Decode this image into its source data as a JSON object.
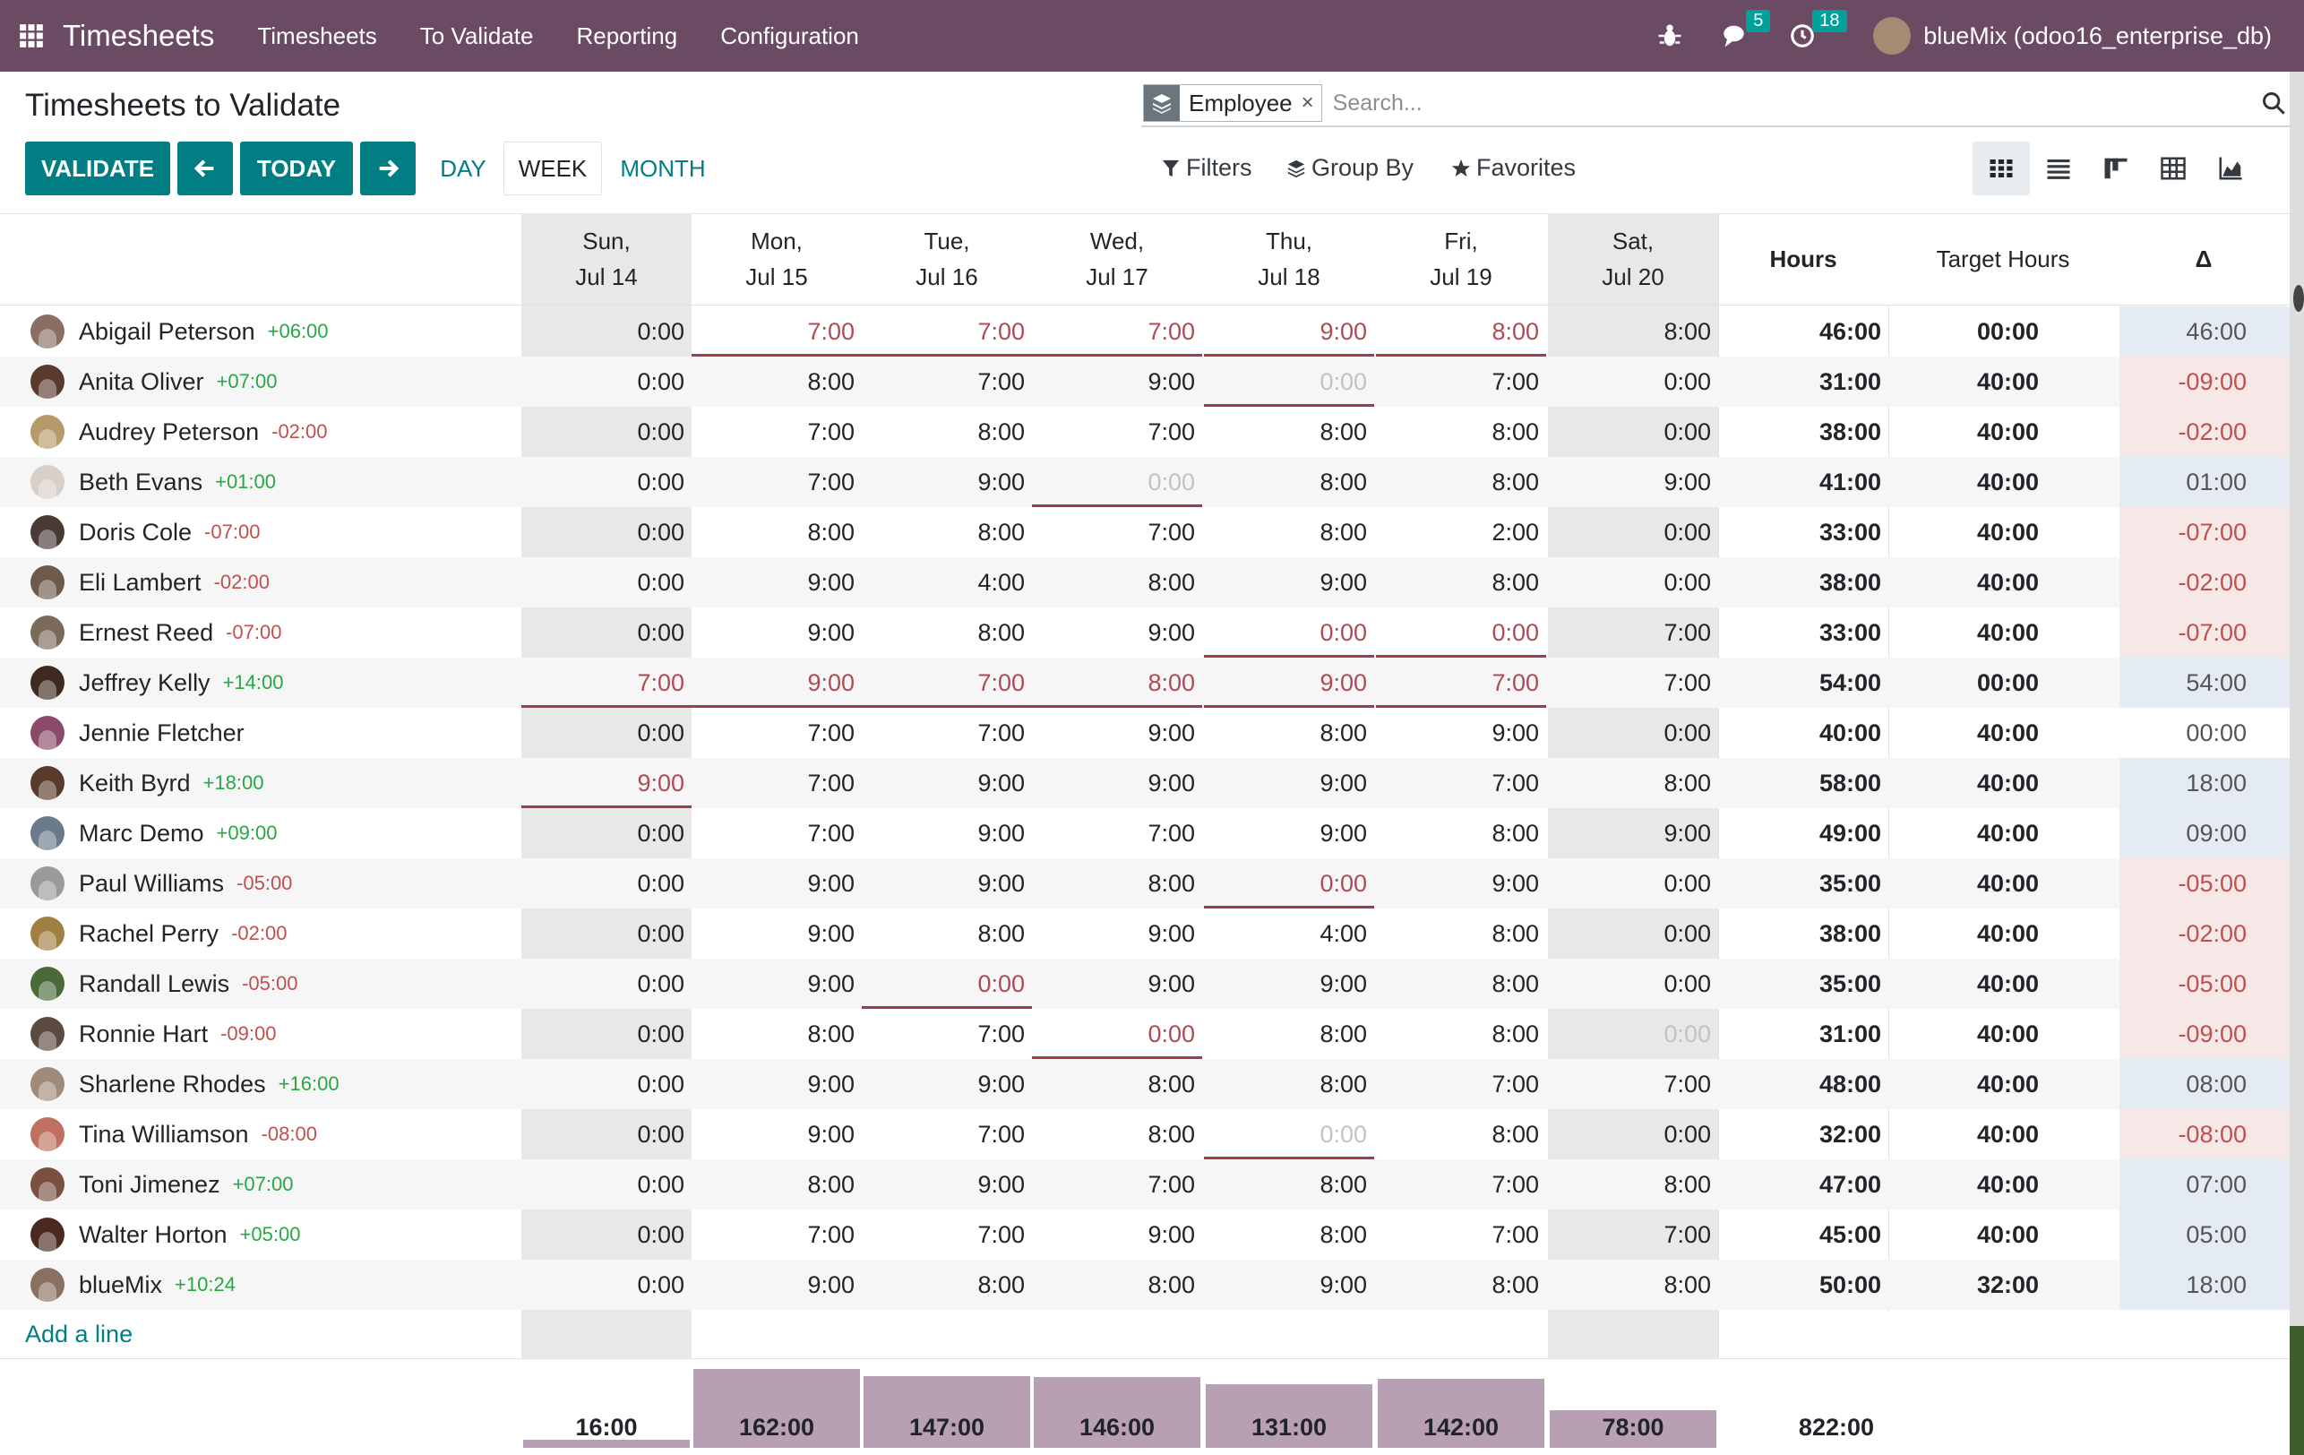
{
  "topbar": {
    "app_title": "Timesheets",
    "menu": [
      "Timesheets",
      "To Validate",
      "Reporting",
      "Configuration"
    ],
    "messages_count": "5",
    "activities_count": "18",
    "user": "blueMix (odoo16_enterprise_db)",
    "icons": [
      "apps-grid-icon",
      "bug-icon",
      "chat-icon",
      "clock-icon"
    ]
  },
  "control": {
    "title": "Timesheets to Validate",
    "validate": "VALIDATE",
    "today": "TODAY",
    "day": "DAY",
    "week": "WEEK",
    "month": "MONTH",
    "filters": "Filters",
    "group_by": "Group By",
    "favorites": "Favorites"
  },
  "search": {
    "facet": "Employee",
    "remove": "×",
    "placeholder": "Search..."
  },
  "columns": {
    "days": [
      {
        "dow": "Sun,",
        "date": "Jul 14"
      },
      {
        "dow": "Mon,",
        "date": "Jul 15"
      },
      {
        "dow": "Tue,",
        "date": "Jul 16"
      },
      {
        "dow": "Wed,",
        "date": "Jul 17"
      },
      {
        "dow": "Thu,",
        "date": "Jul 18"
      },
      {
        "dow": "Fri,",
        "date": "Jul 19"
      },
      {
        "dow": "Sat,",
        "date": "Jul 20"
      }
    ],
    "hours": "Hours",
    "target": "Target Hours",
    "delta": "Δ"
  },
  "rows": [
    {
      "name": "Abigail Peterson",
      "overtime": "+06:00",
      "days": [
        "0:00",
        "7:00",
        "7:00",
        "7:00",
        "9:00",
        "8:00",
        "8:00"
      ],
      "hours": "46:00",
      "target": "00:00",
      "delta": "46:00"
    },
    {
      "name": "Anita Oliver",
      "overtime": "+07:00",
      "days": [
        "0:00",
        "8:00",
        "7:00",
        "9:00",
        "0:00",
        "7:00",
        "0:00"
      ],
      "hours": "31:00",
      "target": "40:00",
      "delta": "-09:00"
    },
    {
      "name": "Audrey Peterson",
      "overtime": "-02:00",
      "days": [
        "0:00",
        "7:00",
        "8:00",
        "7:00",
        "8:00",
        "8:00",
        "0:00"
      ],
      "hours": "38:00",
      "target": "40:00",
      "delta": "-02:00"
    },
    {
      "name": "Beth Evans",
      "overtime": "+01:00",
      "days": [
        "0:00",
        "7:00",
        "9:00",
        "0:00",
        "8:00",
        "8:00",
        "9:00"
      ],
      "hours": "41:00",
      "target": "40:00",
      "delta": "01:00"
    },
    {
      "name": "Doris Cole",
      "overtime": "-07:00",
      "days": [
        "0:00",
        "8:00",
        "8:00",
        "7:00",
        "8:00",
        "2:00",
        "0:00"
      ],
      "hours": "33:00",
      "target": "40:00",
      "delta": "-07:00"
    },
    {
      "name": "Eli Lambert",
      "overtime": "-02:00",
      "days": [
        "0:00",
        "9:00",
        "4:00",
        "8:00",
        "9:00",
        "8:00",
        "0:00"
      ],
      "hours": "38:00",
      "target": "40:00",
      "delta": "-02:00"
    },
    {
      "name": "Ernest Reed",
      "overtime": "-07:00",
      "days": [
        "0:00",
        "9:00",
        "8:00",
        "9:00",
        "0:00",
        "0:00",
        "7:00"
      ],
      "hours": "33:00",
      "target": "40:00",
      "delta": "-07:00"
    },
    {
      "name": "Jeffrey Kelly",
      "overtime": "+14:00",
      "days": [
        "7:00",
        "9:00",
        "7:00",
        "8:00",
        "9:00",
        "7:00",
        "7:00"
      ],
      "hours": "54:00",
      "target": "00:00",
      "delta": "54:00"
    },
    {
      "name": "Jennie Fletcher",
      "overtime": "",
      "days": [
        "0:00",
        "7:00",
        "7:00",
        "9:00",
        "8:00",
        "9:00",
        "0:00"
      ],
      "hours": "40:00",
      "target": "40:00",
      "delta": "00:00"
    },
    {
      "name": "Keith Byrd",
      "overtime": "+18:00",
      "days": [
        "9:00",
        "7:00",
        "9:00",
        "9:00",
        "9:00",
        "7:00",
        "8:00"
      ],
      "hours": "58:00",
      "target": "40:00",
      "delta": "18:00"
    },
    {
      "name": "Marc Demo",
      "overtime": "+09:00",
      "days": [
        "0:00",
        "7:00",
        "9:00",
        "7:00",
        "9:00",
        "8:00",
        "9:00"
      ],
      "hours": "49:00",
      "target": "40:00",
      "delta": "09:00"
    },
    {
      "name": "Paul Williams",
      "overtime": "-05:00",
      "days": [
        "0:00",
        "9:00",
        "9:00",
        "8:00",
        "0:00",
        "9:00",
        "0:00"
      ],
      "hours": "35:00",
      "target": "40:00",
      "delta": "-05:00"
    },
    {
      "name": "Rachel Perry",
      "overtime": "-02:00",
      "days": [
        "0:00",
        "9:00",
        "8:00",
        "9:00",
        "4:00",
        "8:00",
        "0:00"
      ],
      "hours": "38:00",
      "target": "40:00",
      "delta": "-02:00"
    },
    {
      "name": "Randall Lewis",
      "overtime": "-05:00",
      "days": [
        "0:00",
        "9:00",
        "0:00",
        "9:00",
        "9:00",
        "8:00",
        "0:00"
      ],
      "hours": "35:00",
      "target": "40:00",
      "delta": "-05:00"
    },
    {
      "name": "Ronnie Hart",
      "overtime": "-09:00",
      "days": [
        "0:00",
        "8:00",
        "7:00",
        "0:00",
        "8:00",
        "8:00",
        "0:00"
      ],
      "hours": "31:00",
      "target": "40:00",
      "delta": "-09:00"
    },
    {
      "name": "Sharlene Rhodes",
      "overtime": "+16:00",
      "days": [
        "0:00",
        "9:00",
        "9:00",
        "8:00",
        "8:00",
        "7:00",
        "7:00"
      ],
      "hours": "48:00",
      "target": "40:00",
      "delta": "08:00"
    },
    {
      "name": "Tina Williamson",
      "overtime": "-08:00",
      "days": [
        "0:00",
        "9:00",
        "7:00",
        "8:00",
        "0:00",
        "8:00",
        "0:00"
      ],
      "hours": "32:00",
      "target": "40:00",
      "delta": "-08:00"
    },
    {
      "name": "Toni Jimenez",
      "overtime": "+07:00",
      "days": [
        "0:00",
        "8:00",
        "9:00",
        "7:00",
        "8:00",
        "7:00",
        "8:00"
      ],
      "hours": "47:00",
      "target": "40:00",
      "delta": "07:00"
    },
    {
      "name": "Walter Horton",
      "overtime": "+05:00",
      "days": [
        "0:00",
        "7:00",
        "7:00",
        "9:00",
        "8:00",
        "7:00",
        "7:00"
      ],
      "hours": "45:00",
      "target": "40:00",
      "delta": "05:00"
    },
    {
      "name": "blueMix",
      "overtime": "+10:24",
      "days": [
        "0:00",
        "9:00",
        "8:00",
        "8:00",
        "9:00",
        "8:00",
        "8:00"
      ],
      "hours": "50:00",
      "target": "32:00",
      "delta": "18:00"
    }
  ],
  "add_line": "Add a line",
  "totals": {
    "days": [
      "16:00",
      "162:00",
      "147:00",
      "146:00",
      "131:00",
      "142:00",
      "78:00"
    ],
    "grand": "822:00"
  },
  "colors": {
    "topbar": "#6b4a63",
    "primary": "#017e84",
    "positive": "#28a745",
    "negative": "#c0504d",
    "overlimit": "#b04b55",
    "bars": "#b7a0b3"
  }
}
